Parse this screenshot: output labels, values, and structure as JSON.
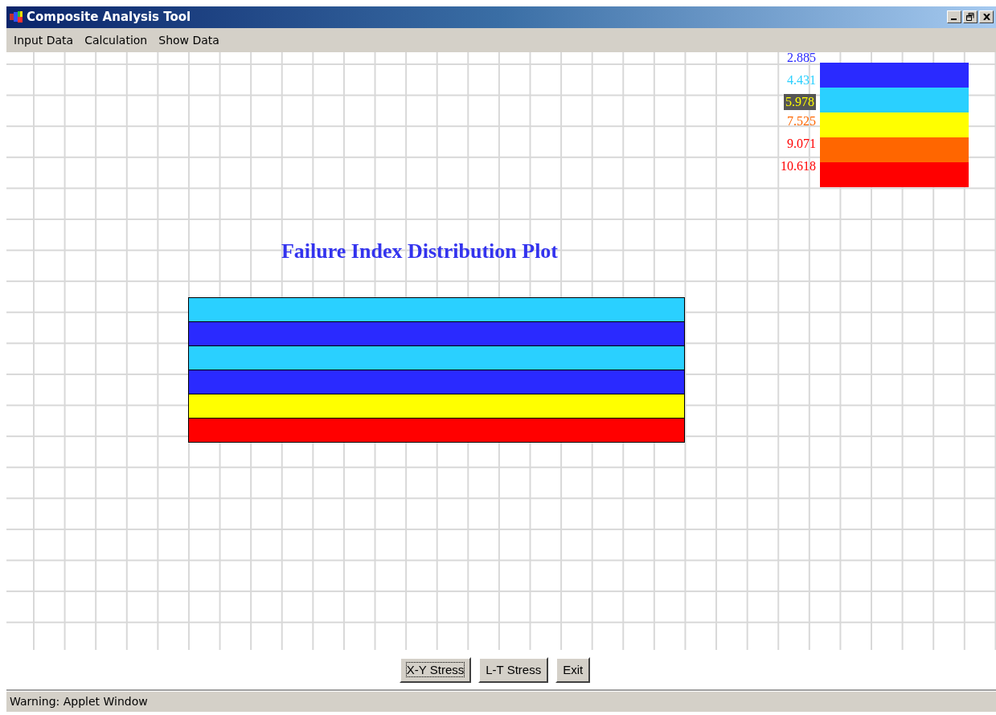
{
  "window": {
    "title": "Composite Analysis Tool"
  },
  "menu": [
    "Input Data",
    "Calculation",
    "Show Data"
  ],
  "plot": {
    "title": "Failure Index Distribution Plot",
    "legend": [
      "2.885",
      "4.431",
      "5.978",
      "7.525",
      "9.071",
      "10.618"
    ],
    "bands": [
      {
        "color": "#2a2aff"
      },
      {
        "color": "#2ad0ff"
      },
      {
        "color": "#ffff00"
      },
      {
        "color": "#ff6600"
      },
      {
        "color": "#ff0000"
      }
    ],
    "layers": [
      {
        "color": "#2ad0ff"
      },
      {
        "color": "#2a2aff"
      },
      {
        "color": "#2ad0ff"
      },
      {
        "color": "#2a2aff"
      },
      {
        "color": "#ffff00"
      },
      {
        "color": "#ff0000"
      }
    ]
  },
  "buttons": [
    {
      "label": "X-Y Stress",
      "focused": true
    },
    {
      "label": "L-T Stress",
      "focused": false
    },
    {
      "label": "Exit",
      "focused": false
    }
  ],
  "status_bar": "Warning: Applet Window"
}
